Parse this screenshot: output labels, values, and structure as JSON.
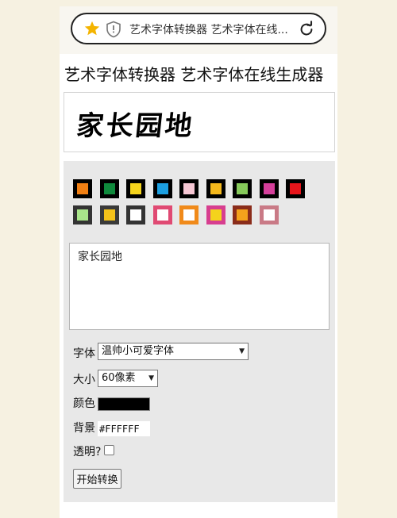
{
  "browser": {
    "url_text": "艺术字体转换器 艺术字体在线..."
  },
  "page": {
    "title": "艺术字体转换器 艺术字体在线生成器",
    "preview_text": "家长园地"
  },
  "palette": {
    "swatches": [
      {
        "fill": "#f07f13",
        "border": "#000000"
      },
      {
        "fill": "#0f8a3c",
        "border": "#000000"
      },
      {
        "fill": "#f4d31c",
        "border": "#000000"
      },
      {
        "fill": "#1c9fe0",
        "border": "#000000"
      },
      {
        "fill": "#f6c7d4",
        "border": "#000000"
      },
      {
        "fill": "#f4b81c",
        "border": "#000000"
      },
      {
        "fill": "#86c95a",
        "border": "#000000"
      },
      {
        "fill": "#d53f9b",
        "border": "#000000"
      },
      {
        "fill": "#e8151b",
        "border": "#000000"
      },
      {
        "fill": "#a9e68a",
        "border": "#333333"
      },
      {
        "fill": "#f4c21a",
        "border": "#3a3a3a"
      },
      {
        "fill": "#ffffff",
        "border": "#333333"
      },
      {
        "fill": "#ffffff",
        "border": "#e04a73"
      },
      {
        "fill": "#ffffff",
        "border": "#f08a1a"
      },
      {
        "fill": "#f4d31c",
        "border": "#d73e8f"
      },
      {
        "fill": "#f4a21c",
        "border": "#8a2c1a"
      },
      {
        "fill": "#ffffff",
        "border": "#c97a86"
      }
    ]
  },
  "form": {
    "text_value": "家长园地",
    "font_label": "字体",
    "font_value": "温帅小可爱字体",
    "size_label": "大小",
    "size_value": "60像素",
    "color_label": "颜色",
    "color_value": "#000000",
    "bg_label": "背景",
    "bg_value": "#FFFFFF",
    "transparent_label": "透明?",
    "submit_label": "开始转换"
  }
}
